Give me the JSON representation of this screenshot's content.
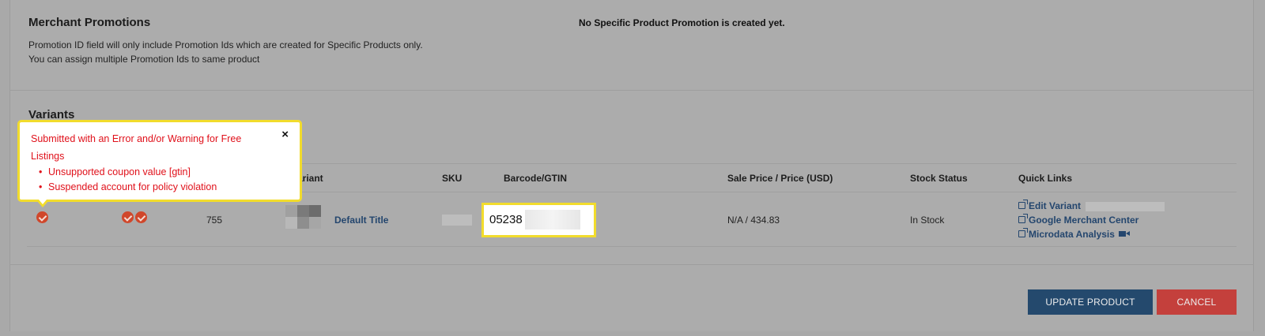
{
  "promotions": {
    "title": "Merchant Promotions",
    "note": "Promotion ID field will only include Promotion Ids which are created for Specific Products only. You can assign multiple Promotion Ids to same product",
    "empty_message": "No Specific Product Promotion is created yet."
  },
  "variants": {
    "title": "Variants",
    "headers": {
      "variant": "ariant",
      "sku": "SKU",
      "barcode": "Barcode/GTIN",
      "price": "Sale Price / Price (USD)",
      "stock": "Stock Status",
      "quick_links": "Quick Links"
    },
    "row": {
      "position": "755",
      "variant_title": "Default Title",
      "barcode_value": "05238",
      "price": "N/A / 434.83",
      "stock_status": "In Stock",
      "status_color": "#d0472b"
    },
    "quick_links": {
      "edit_variant": "Edit Variant",
      "merchant_center": "Google Merchant Center",
      "microdata": "Microdata Analysis"
    }
  },
  "popover": {
    "title": "Submitted with an Error and/or Warning for Free Listings",
    "close": "×",
    "items": [
      "Unsupported coupon value [gtin]",
      "Suspended account for policy violation"
    ],
    "border_color": "#f2dc2c",
    "text_color": "#e0101a"
  },
  "actions": {
    "update": "UPDATE PRODUCT",
    "cancel": "CANCEL"
  }
}
